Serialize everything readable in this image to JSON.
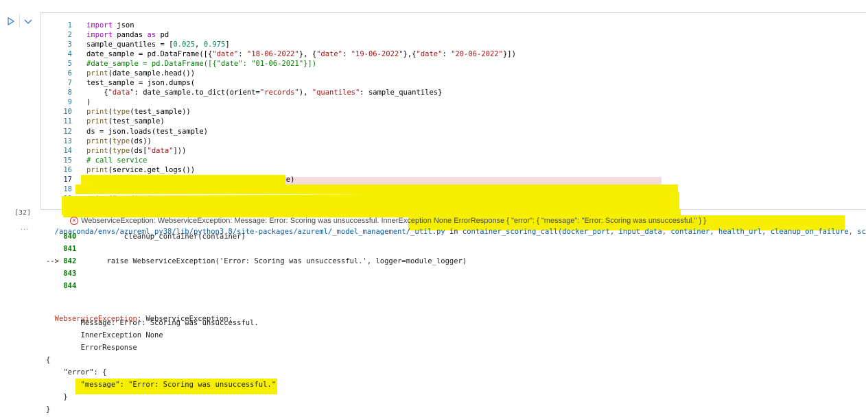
{
  "cell": {
    "execution_count": "[32]",
    "output_ellipsis": "...",
    "code_lines": [
      {
        "num": "1",
        "html": "<span class='k'>import</span> json"
      },
      {
        "num": "2",
        "html": "<span class='k'>import</span> pandas <span class='k'>as</span> pd"
      },
      {
        "num": "3",
        "html": "sample_quantiles = [<span class='n'>0.025</span>, <span class='n'>0.975</span>]"
      },
      {
        "num": "4",
        "html": "date_sample = pd.DataFrame([{<span class='s'>\"date\"</span>: <span class='s'>\"18-06-2022\"</span>}, {<span class='s'>\"date\"</span>: <span class='s'>\"19-06-2022\"</span>},{<span class='s'>\"date\"</span>: <span class='s'>\"20-06-2022\"</span>}])"
      },
      {
        "num": "5",
        "html": "<span class='c'>#date_sample = pd.DataFrame([{\"date\": \"01-06-2021\"}])</span>"
      },
      {
        "num": "6",
        "html": "<span class='f'>print</span>(date_sample.head())"
      },
      {
        "num": "7",
        "html": "test_sample = json.dumps("
      },
      {
        "num": "8",
        "html": "    {<span class='s'>\"data\"</span>: date_sample.to_dict(orient=<span class='s'>\"records\"</span>), <span class='s'>\"quantiles\"</span>: sample_quantiles}"
      },
      {
        "num": "9",
        "html": ")"
      },
      {
        "num": "10",
        "html": "<span class='f'>print</span>(<span class='f'>type</span>(test_sample))"
      },
      {
        "num": "11",
        "html": "<span class='f'>print</span>(test_sample)"
      },
      {
        "num": "12",
        "html": "ds = json.loads(test_sample)"
      },
      {
        "num": "13",
        "html": "<span class='f'>print</span>(<span class='f'>type</span>(ds))"
      },
      {
        "num": "14",
        "html": "<span class='f'>print</span>(<span class='f'>type</span>(ds[<span class='s'>\"data\"</span>]))"
      },
      {
        "num": "15",
        "html": "<span class='c'># call service</span>"
      },
      {
        "num": "16",
        "html": "<span class='f'>print</span>(service.get_logs())"
      },
      {
        "num": "17",
        "html": "prediction = service.run(input_data=test_sample)"
      },
      {
        "num": "18",
        "html": "<span class='f'>print</span>(service.get_logs())"
      },
      {
        "num": "19",
        "html": "<span class='f'>print</span>(<span class='s'>\"prediction cpu\"</span>,prediction)"
      }
    ],
    "current_line": "17"
  },
  "output": {
    "error_header": "WebserviceException: WebserviceException: Message: Error: Scoring was unsuccessful. InnerException None ErrorResponse { \"error\": { \"message\": \"Error: Scoring was unsuccessful.\" } }",
    "trace_path": "/anaconda/envs/azureml_py38/lib/python3.8/site-packages/azureml/_model_management/_util.py",
    "trace_in": " in ",
    "trace_func": "container_scoring_call(docker_port, input_data, container, health_url, cleanup_on_failure, score_url)",
    "trace_lines": [
      {
        "prefix": "    ",
        "num": "840",
        "code": "           cleanup_container(container)"
      },
      {
        "prefix": "    ",
        "num": "841",
        "code": ""
      },
      {
        "prefix": "--> ",
        "num": "842",
        "code": "       raise WebserviceException('Error: Scoring was unsuccessful.', logger=module_logger)"
      },
      {
        "prefix": "    ",
        "num": "843",
        "code": ""
      },
      {
        "prefix": "    ",
        "num": "844",
        "code": ""
      }
    ],
    "exception_name": "WebserviceException",
    "exception_rest": ": WebserviceException:",
    "message_lines": [
      "        Message: Error: Scoring was unsuccessful.",
      "        InnerException None",
      "        ErrorResponse",
      "{",
      "    \"error\": {",
      "        \"message\": \"Error: Scoring was unsuccessful.\"",
      "    }",
      "}"
    ]
  },
  "colors": {
    "highlighter": "#f6f000",
    "current_line_bg": "#f5dcdc",
    "line_number": "#237893"
  }
}
